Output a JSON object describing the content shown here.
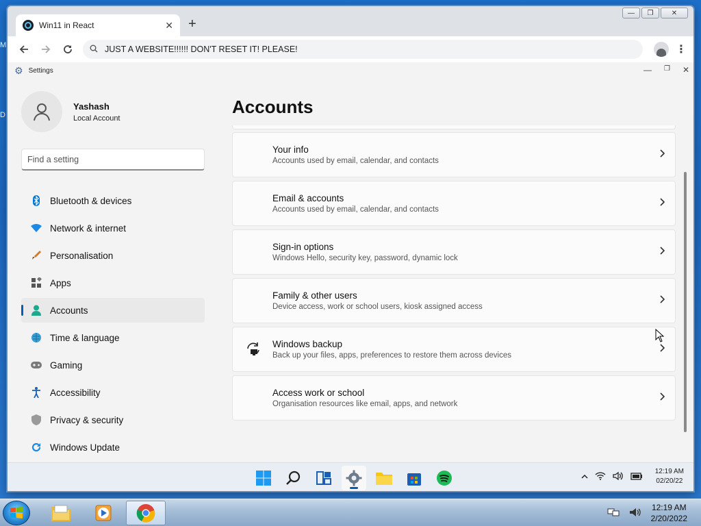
{
  "browser": {
    "tab_title": "Win11 in React",
    "address": "JUST A WEBSITE!!!!!! DON'T RESET IT! PLEASE!"
  },
  "settings": {
    "window_title": "Settings",
    "user": {
      "name": "Yashash",
      "account_type": "Local Account"
    },
    "search_placeholder": "Find a setting",
    "nav": [
      {
        "label": "Bluetooth & devices",
        "icon": "bluetooth-icon",
        "active": false
      },
      {
        "label": "Network & internet",
        "icon": "wifi-icon",
        "active": false
      },
      {
        "label": "Personalisation",
        "icon": "brush-icon",
        "active": false
      },
      {
        "label": "Apps",
        "icon": "apps-icon",
        "active": false
      },
      {
        "label": "Accounts",
        "icon": "person-icon",
        "active": true
      },
      {
        "label": "Time & language",
        "icon": "globe-clock-icon",
        "active": false
      },
      {
        "label": "Gaming",
        "icon": "gamepad-icon",
        "active": false
      },
      {
        "label": "Accessibility",
        "icon": "accessibility-icon",
        "active": false
      },
      {
        "label": "Privacy & security",
        "icon": "shield-icon",
        "active": false
      },
      {
        "label": "Windows Update",
        "icon": "update-icon",
        "active": false
      }
    ],
    "page_title": "Accounts",
    "cards": [
      {
        "title": "Your info",
        "desc": "Accounts used by email, calendar, and contacts",
        "icon": ""
      },
      {
        "title": "Email & accounts",
        "desc": "Accounts used by email, calendar, and contacts",
        "icon": ""
      },
      {
        "title": "Sign-in options",
        "desc": "Windows Hello, security key, password, dynamic lock",
        "icon": ""
      },
      {
        "title": "Family & other users",
        "desc": "Device access, work or school users, kiosk assigned access",
        "icon": ""
      },
      {
        "title": "Windows backup",
        "desc": "Back up your files, apps, preferences to restore them across devices",
        "icon": "backup-icon"
      },
      {
        "title": "Access work or school",
        "desc": "Organisation resources like email, apps, and network",
        "icon": ""
      }
    ]
  },
  "win11_taskbar": {
    "time": "12:19 AM",
    "date": "02/20/22"
  },
  "win7_taskbar": {
    "time": "12:19 AM",
    "date": "2/20/2022"
  },
  "colors": {
    "accent": "#005fb8",
    "desktop": "#1d6fc9"
  }
}
